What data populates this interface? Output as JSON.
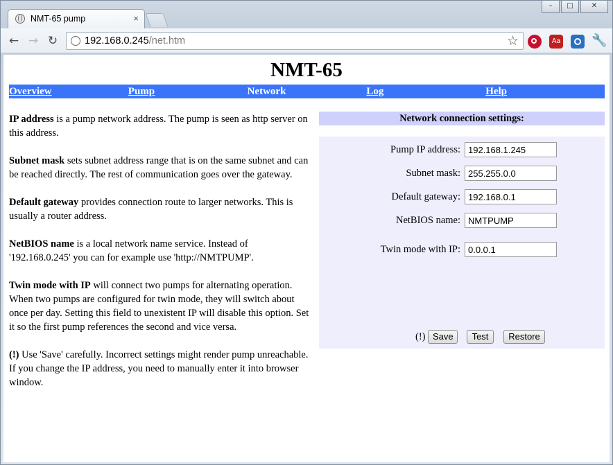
{
  "browser": {
    "tab_title": "NMT-65 pump",
    "tab_close": "×",
    "url_host": "192.168.0.245",
    "url_path": "/net.htm",
    "win_min": "–",
    "win_max": "□",
    "win_close": "✕",
    "back": "←",
    "forward": "→",
    "reload": "↻",
    "star": "☆",
    "dict_ext": "Aa",
    "wrench": "🔧"
  },
  "page": {
    "title": "NMT-65",
    "menu": [
      {
        "label": "Overview"
      },
      {
        "label": "Pump"
      },
      {
        "label": "Network"
      },
      {
        "label": "Log"
      },
      {
        "label": "Help"
      }
    ],
    "help": [
      {
        "term": "IP address",
        "text": " is a pump network address. The pump is seen as http server on this address."
      },
      {
        "term": "Subnet mask",
        "text": " sets subnet address range that is on the same subnet and can be reached directly. The rest of communication goes over the gateway."
      },
      {
        "term": "Default gateway",
        "text": " provides connection route to larger networks. This is usually a router address."
      },
      {
        "term": "NetBIOS name",
        "text": " is a local network name service. Instead of '192.168.0.245' you can for example use 'http://NMTPUMP'."
      },
      {
        "term": "Twin mode with IP",
        "text": " will connect two pumps for alternating operation. When two pumps are configured for twin mode, they will switch about once per day. Setting this field to unexistent IP will disable this option. Set it so the first pump references the second and vice versa."
      },
      {
        "term": "(!)",
        "text": " Use 'Save' carefully. Incorrect settings might render pump unreachable. If you change the IP address, you need to manually enter it into browser window."
      }
    ],
    "settings": {
      "header": "Network connection settings:",
      "fields": [
        {
          "label": "Pump IP address:",
          "value": "192.168.1.245"
        },
        {
          "label": "Subnet mask:",
          "value": "255.255.0.0"
        },
        {
          "label": "Default gateway:",
          "value": "192.168.0.1"
        },
        {
          "label": "NetBIOS name:",
          "value": "NMTPUMP"
        },
        {
          "label": "Twin mode with IP:",
          "value": "0.0.0.1"
        }
      ],
      "warning": "(!)",
      "save_label": "Save",
      "test_label": "Test",
      "restore_label": "Restore"
    }
  },
  "colors": {
    "menu_bg": "#3a74f8",
    "panel_header_bg": "#cfd0fc",
    "panel_bg": "#eeeefd"
  }
}
